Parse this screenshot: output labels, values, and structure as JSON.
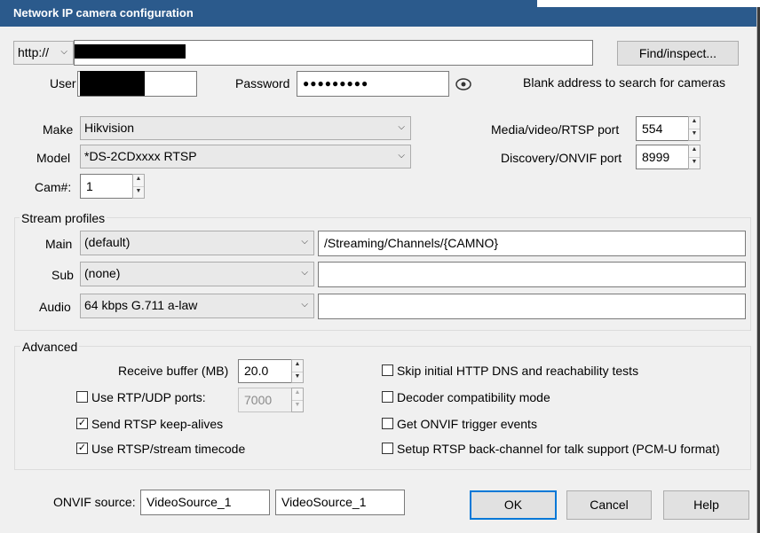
{
  "window": {
    "title": "Network IP camera configuration"
  },
  "address": {
    "protocol": "http://",
    "find_label": "Find/inspect..."
  },
  "credentials": {
    "user_label": "User",
    "password_label": "Password",
    "password_value": "●●●●●●●●●",
    "hint": "Blank address to search for cameras"
  },
  "device": {
    "make_label": "Make",
    "make_value": "Hikvision",
    "model_label": "Model",
    "model_value": "*DS-2CDxxxx RTSP",
    "cam_label": "Cam#:",
    "cam_value": "1",
    "media_port_label": "Media/video/RTSP port",
    "media_port_value": "554",
    "onvif_port_label": "Discovery/ONVIF port",
    "onvif_port_value": "8999"
  },
  "stream": {
    "title": "Stream profiles",
    "rows": [
      {
        "label": "Main",
        "profile": "(default)",
        "path": "/Streaming/Channels/{CAMNO}"
      },
      {
        "label": "Sub",
        "profile": "(none)",
        "path": ""
      },
      {
        "label": "Audio",
        "profile": "64 kbps G.711 a-law",
        "path": ""
      }
    ]
  },
  "advanced": {
    "title": "Advanced",
    "receive_buffer_label": "Receive buffer (MB)",
    "receive_buffer_value": "20.0",
    "rtp_udp_label": "Use RTP/UDP ports:",
    "rtp_udp_checked": false,
    "rtp_udp_value": "7000",
    "keepalive_label": "Send RTSP keep-alives",
    "keepalive_checked": true,
    "timecode_label": "Use RTSP/stream timecode",
    "timecode_checked": true,
    "skip_dns_label": "Skip initial HTTP DNS and reachability tests",
    "decoder_compat_label": "Decoder compatibility mode",
    "onvif_trigger_label": "Get ONVIF trigger events",
    "backchannel_label": "Setup RTSP back-channel for talk support (PCM-U format)"
  },
  "onvif": {
    "label": "ONVIF source:",
    "source1": "VideoSource_1",
    "source2": "VideoSource_1"
  },
  "buttons": {
    "ok": "OK",
    "cancel": "Cancel",
    "help": "Help"
  }
}
